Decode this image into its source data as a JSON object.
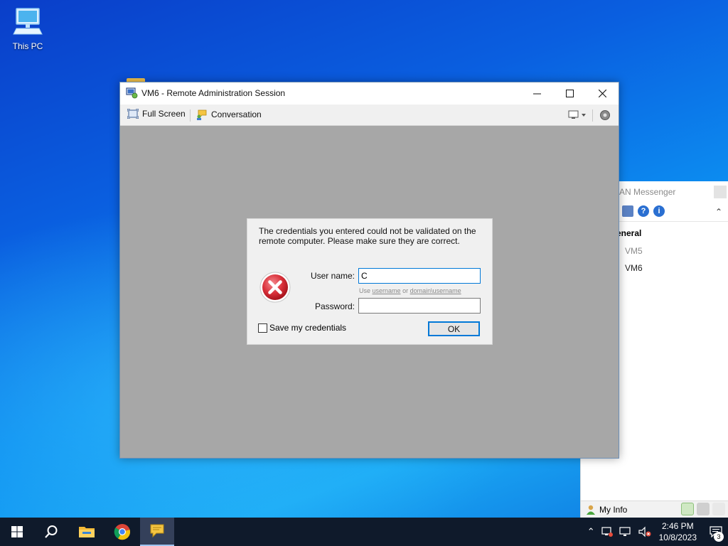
{
  "desktop": {
    "icons": [
      {
        "label": "This PC",
        "icon": "computer-icon"
      }
    ]
  },
  "messenger": {
    "title_partial": "AN Messenger",
    "group": "eneral",
    "contacts": [
      "VM5",
      "VM6"
    ],
    "status_label": "My Info"
  },
  "window": {
    "title": "VM6 - Remote Administration Session",
    "toolbar": {
      "full_screen": "Full Screen",
      "conversation": "Conversation"
    }
  },
  "dialog": {
    "message": "The credentials you entered could not be validated on the remote computer. Please make sure they are correct.",
    "username_label": "User name:",
    "username_value": "C",
    "hint_prefix": "Use",
    "hint_link1": "username",
    "hint_mid": "or",
    "hint_link2": "domain\\username",
    "password_label": "Password:",
    "password_value": "",
    "save_label": "Save my credentials",
    "save_checked": false,
    "ok_label": "OK"
  },
  "taskbar": {
    "time": "2:46 PM",
    "date": "10/8/2023",
    "notification_count": "3"
  },
  "colors": {
    "accent": "#0078d7",
    "error_red": "#d9303a",
    "remote_area": "#a7a7a7"
  }
}
